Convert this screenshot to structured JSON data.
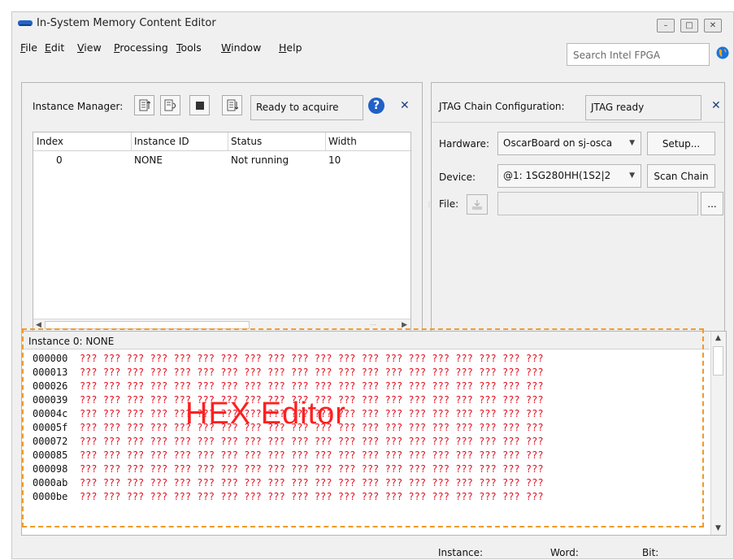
{
  "window": {
    "title": "In-System Memory Content Editor"
  },
  "menu": {
    "items": [
      {
        "label": "File",
        "ul": "F",
        "rest": "ile"
      },
      {
        "label": "Edit",
        "ul": "E",
        "rest": "dit"
      },
      {
        "label": "View",
        "ul": "V",
        "rest": "iew"
      },
      {
        "label": "Processing",
        "ul": "P",
        "rest": "rocessing"
      },
      {
        "label": "Tools",
        "ul": "T",
        "rest": "ools"
      },
      {
        "label": "Window",
        "ul": "W",
        "rest": "indow"
      },
      {
        "label": "Help",
        "ul": "H",
        "rest": "elp"
      }
    ]
  },
  "search": {
    "placeholder": "Search Intel FPGA"
  },
  "instance_manager": {
    "label": "Instance Manager:",
    "status": "Ready to acquire",
    "columns": [
      "Index",
      "Instance ID",
      "Status",
      "Width"
    ],
    "rows": [
      {
        "index": "0",
        "instance_id": "NONE",
        "status": "Not running",
        "width": "10"
      }
    ]
  },
  "jtag": {
    "label": "JTAG Chain Configuration:",
    "status": "JTAG ready",
    "hardware_label": "Hardware:",
    "hardware_value": "OscarBoard on sj-osca",
    "setup_button": "Setup...",
    "device_label": "Device:",
    "device_value": "@1: 1SG280HH(1S2|2",
    "scan_button": "Scan Chain",
    "file_label": "File:",
    "browse_button": "..."
  },
  "hex_editor": {
    "header": "Instance 0: NONE",
    "overlay": "HEX Editor",
    "rows": [
      {
        "addr": "000000",
        "vals": "??? ??? ??? ??? ??? ??? ??? ??? ??? ??? ??? ??? ??? ??? ??? ??? ??? ??? ??? ???"
      },
      {
        "addr": "000013",
        "vals": "??? ??? ??? ??? ??? ??? ??? ??? ??? ??? ??? ??? ??? ??? ??? ??? ??? ??? ??? ???"
      },
      {
        "addr": "000026",
        "vals": "??? ??? ??? ??? ??? ??? ??? ??? ??? ??? ??? ??? ??? ??? ??? ??? ??? ??? ??? ???"
      },
      {
        "addr": "000039",
        "vals": "??? ??? ??? ??? ??? ??? ??? ??? ??? ??? ??? ??? ??? ??? ??? ??? ??? ??? ??? ???"
      },
      {
        "addr": "00004c",
        "vals": "??? ??? ??? ??? ??? ??? ??? ??? ??? ??? ??? ??? ??? ??? ??? ??? ??? ??? ??? ???"
      },
      {
        "addr": "00005f",
        "vals": "??? ??? ??? ??? ??? ??? ??? ??? ??? ??? ??? ??? ??? ??? ??? ??? ??? ??? ??? ???"
      },
      {
        "addr": "000072",
        "vals": "??? ??? ??? ??? ??? ??? ??? ??? ??? ??? ??? ??? ??? ??? ??? ??? ??? ??? ??? ???"
      },
      {
        "addr": "000085",
        "vals": "??? ??? ??? ??? ??? ??? ??? ??? ??? ??? ??? ??? ??? ??? ??? ??? ??? ??? ??? ???"
      },
      {
        "addr": "000098",
        "vals": "??? ??? ??? ??? ??? ??? ??? ??? ??? ??? ??? ??? ??? ??? ??? ??? ??? ??? ??? ???"
      },
      {
        "addr": "0000ab",
        "vals": "??? ??? ??? ??? ??? ??? ??? ??? ??? ??? ??? ??? ??? ??? ??? ??? ??? ??? ??? ???"
      },
      {
        "addr": "0000be",
        "vals": "??? ??? ??? ??? ??? ??? ??? ??? ??? ??? ??? ??? ??? ??? ??? ??? ??? ??? ??? ???"
      }
    ]
  },
  "statusbar": {
    "instance": "Instance:",
    "word": "Word:",
    "bit": "Bit:"
  },
  "colors": {
    "hex_values": "#e01020",
    "annotation_box": "#f09a2a",
    "help_icon": "#2060c8"
  }
}
